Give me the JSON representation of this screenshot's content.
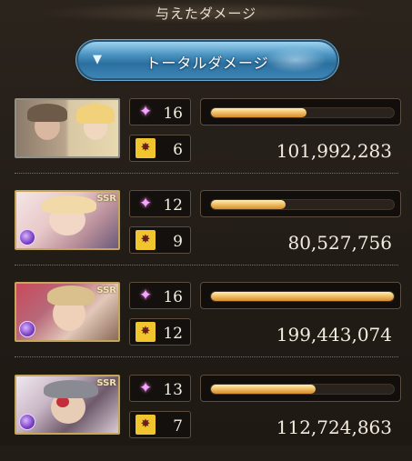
{
  "header": {
    "title": "与えたダメージ"
  },
  "total_button": {
    "label": "トータルダメージ",
    "caret": "▼"
  },
  "rows": [
    {
      "skill": "16",
      "chain": "6",
      "damage": "101,992,283",
      "bar": 0.52,
      "ssr": "",
      "element": ""
    },
    {
      "skill": "12",
      "chain": "9",
      "damage": "80,527,756",
      "bar": 0.41,
      "ssr": "SSR",
      "element": "dark"
    },
    {
      "skill": "16",
      "chain": "12",
      "damage": "199,443,074",
      "bar": 1.0,
      "ssr": "SSR",
      "element": "dark"
    },
    {
      "skill": "13",
      "chain": "7",
      "damage": "112,724,863",
      "bar": 0.57,
      "ssr": "SSR",
      "element": "dark"
    }
  ],
  "icons": {
    "skill": "sparkle-icon",
    "chain": "chain-burst-icon"
  },
  "colors": {
    "bar": "#f2c16a",
    "accent": "#4b95c2"
  }
}
